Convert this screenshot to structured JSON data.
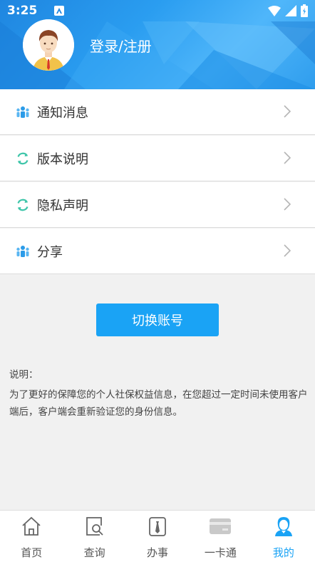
{
  "status_bar": {
    "time": "3:25"
  },
  "header": {
    "login_label": "登录/注册"
  },
  "menu": [
    {
      "label": "通知消息",
      "icon": "people-icon"
    },
    {
      "label": "版本说明",
      "icon": "refresh-icon"
    },
    {
      "label": "隐私声明",
      "icon": "refresh-icon"
    },
    {
      "label": "分享",
      "icon": "people-icon"
    }
  ],
  "switch_account_label": "切换账号",
  "note": {
    "title": "说明：",
    "body": "为了更好的保障您的个人社保权益信息，在您超过一定时间未使用客户端后，客户端会重新验证您的身份信息。"
  },
  "tabs": [
    {
      "label": "首页",
      "icon": "home-icon",
      "active": false
    },
    {
      "label": "查询",
      "icon": "search-icon",
      "active": false
    },
    {
      "label": "办事",
      "icon": "tie-icon",
      "active": false
    },
    {
      "label": "一卡通",
      "icon": "card-icon",
      "active": false
    },
    {
      "label": "我的",
      "icon": "user-icon",
      "active": true
    }
  ],
  "colors": {
    "primary": "#1aa3f5",
    "header": "#2a9df0"
  }
}
